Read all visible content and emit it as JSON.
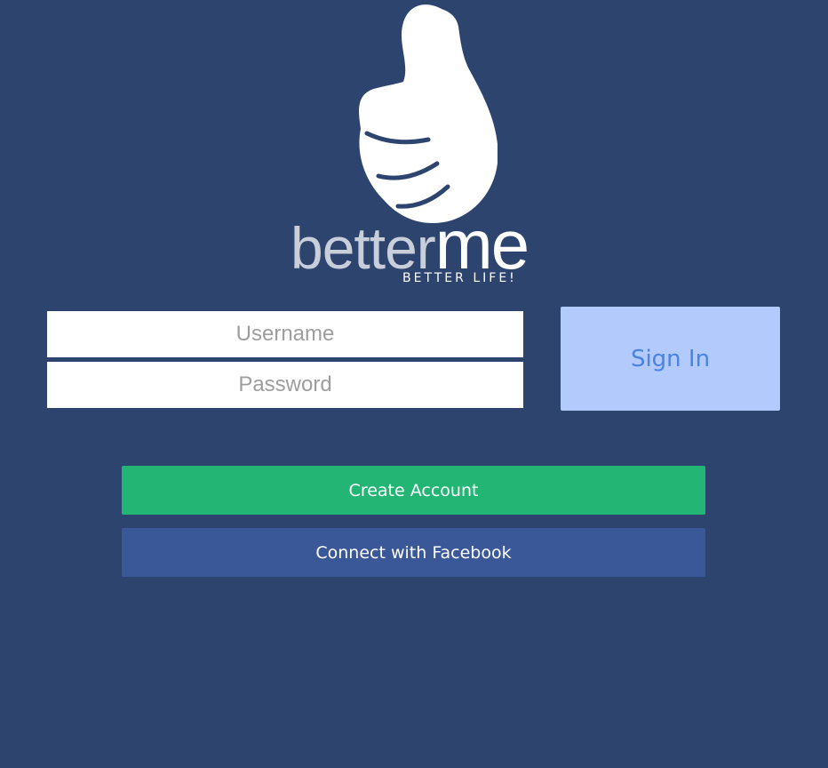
{
  "brand": {
    "wordmark_part1": "better",
    "wordmark_part2": "me",
    "tagline": "BETTER LIFE!"
  },
  "login": {
    "username_placeholder": "Username",
    "password_placeholder": "Password",
    "sign_in_label": "Sign In"
  },
  "actions": {
    "create_account_label": "Create Account",
    "facebook_label": "Connect with Facebook"
  },
  "colors": {
    "background": "#2d446f",
    "sign_in_bg": "#b3cafd",
    "sign_in_text": "#4b83e1",
    "create_account_bg": "#22b573",
    "facebook_bg": "#3a5897"
  },
  "icons": {
    "logo_icon": "thumbs-up-icon"
  }
}
